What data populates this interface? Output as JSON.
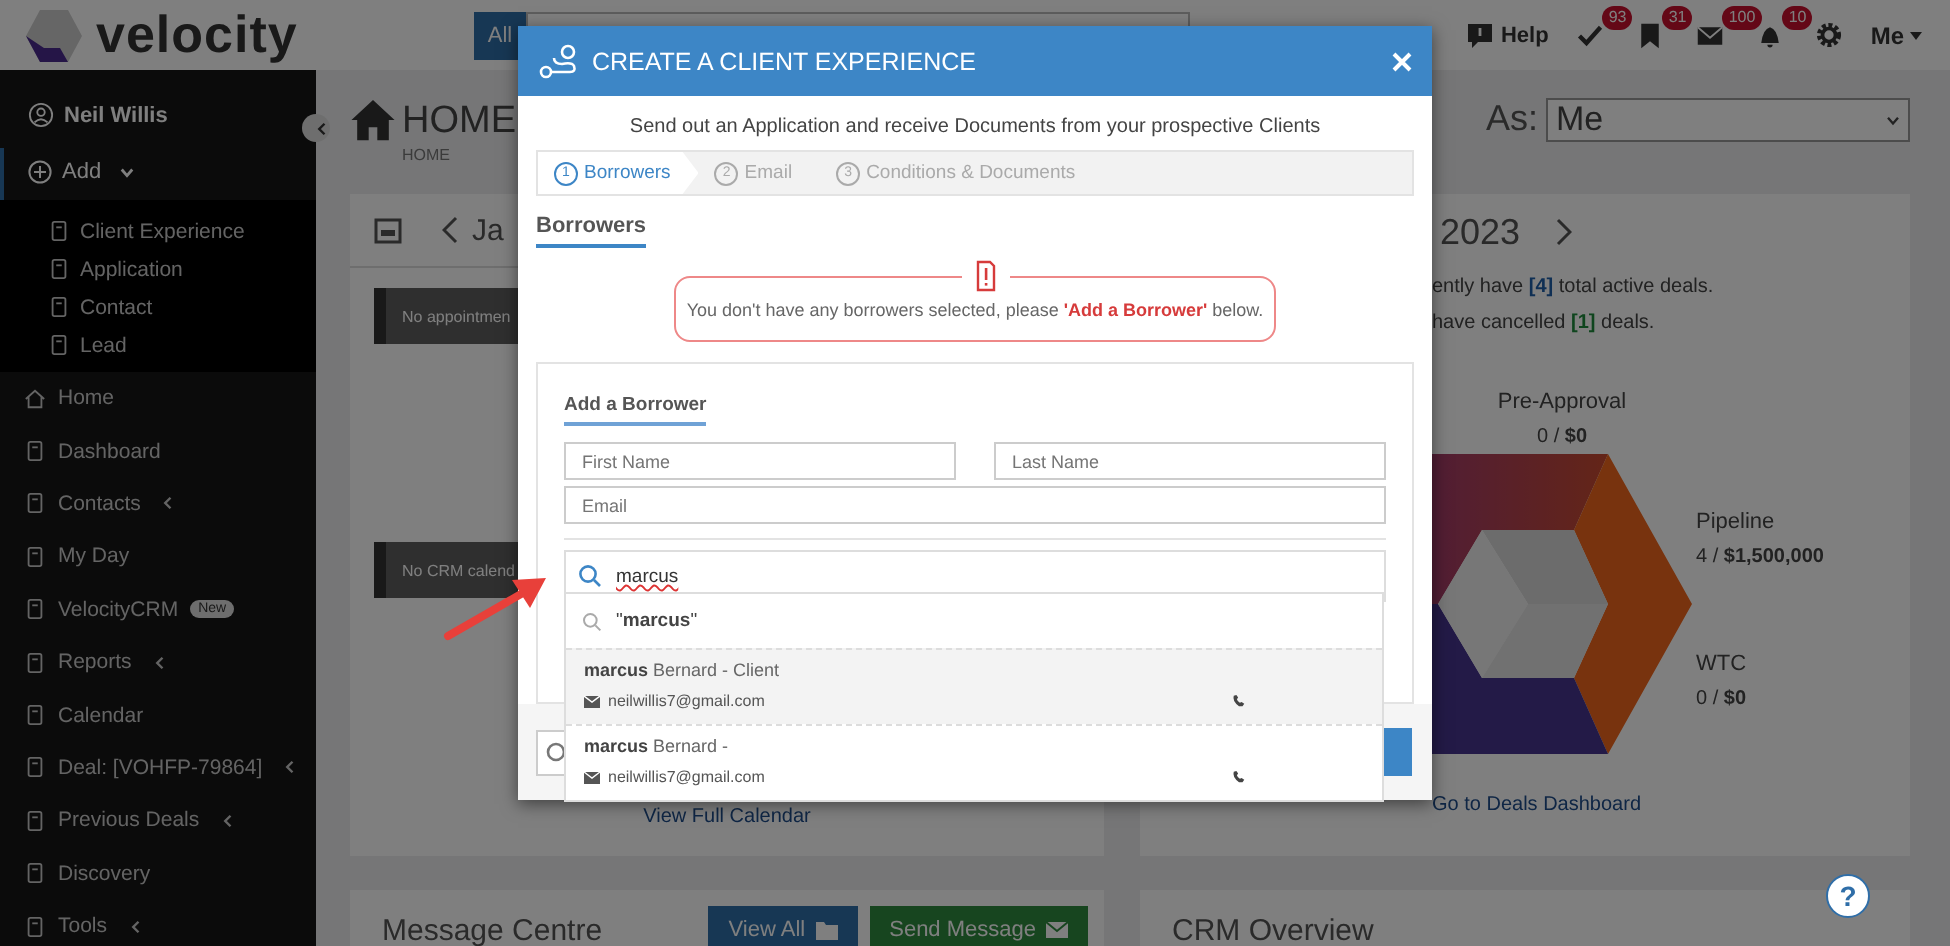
{
  "topbar": {
    "logo": "velocity",
    "search_scope": "All",
    "help": "Help",
    "notifications": [
      {
        "badge": "93"
      },
      {
        "badge": "31"
      },
      {
        "badge": "100"
      },
      {
        "badge": "10"
      }
    ],
    "user_menu": "Me"
  },
  "sidebar": {
    "user": "Neil Willis",
    "add": {
      "label": "Add",
      "expanded": true,
      "children": [
        {
          "label": "Client Experience"
        },
        {
          "label": "Application"
        },
        {
          "label": "Contact"
        },
        {
          "label": "Lead"
        }
      ]
    },
    "items": [
      {
        "label": "Home",
        "kind": "link"
      },
      {
        "label": "Dashboard",
        "kind": "link"
      },
      {
        "label": "Contacts",
        "kind": "submenu"
      },
      {
        "label": "My Day",
        "kind": "link"
      },
      {
        "label": "VelocityCRM",
        "kind": "link",
        "badge": "New"
      },
      {
        "label": "Reports",
        "kind": "submenu"
      },
      {
        "label": "Calendar",
        "kind": "link"
      },
      {
        "label": "Deal: [VOHFP-79864]",
        "kind": "submenu"
      },
      {
        "label": "Previous Deals",
        "kind": "submenu"
      },
      {
        "label": "Discovery",
        "kind": "link"
      },
      {
        "label": "Tools",
        "kind": "submenu"
      }
    ]
  },
  "page_header": {
    "title": "HOME",
    "breadcrumb": "HOME",
    "as_label": "As:",
    "as_value": "Me"
  },
  "calendar_card": {
    "month": "Ja",
    "notices": [
      "No appointmen",
      "No CRM calend"
    ],
    "link": "View Full Calendar"
  },
  "deals_card": {
    "year": "2023",
    "lines": [
      {
        "before": "ently have ",
        "count": "[4]",
        "after": " total active deals.",
        "kind": "active"
      },
      {
        "before": "have cancelled ",
        "count": "[1]",
        "after": " deals.",
        "kind": "cancelled"
      }
    ],
    "stages": [
      {
        "name": "Pre-Approval",
        "value": "0 / **$0**"
      },
      {
        "name": "Pipeline",
        "value": "4 / **$1,500,000**"
      },
      {
        "name": "WTC",
        "value": "0 / **$0**"
      }
    ],
    "link": "Go to Deals Dashboard"
  },
  "message_centre": {
    "title": "Message Centre",
    "buttons": [
      {
        "label": "View All",
        "kind": "primary"
      },
      {
        "label": "Send Message",
        "kind": "success"
      }
    ]
  },
  "crm_overview": {
    "title": "CRM Overview"
  },
  "help_button": "?",
  "modal": {
    "title": "CREATE A CLIENT EXPERIENCE",
    "subtitle": "Send out an Application and receive Documents from your prospective Clients",
    "steps": [
      {
        "number": "1",
        "label": "Borrowers",
        "selected": true
      },
      {
        "number": "2",
        "label": "Email",
        "selected": false
      },
      {
        "number": "3",
        "label": "Conditions & Documents",
        "selected": false
      }
    ],
    "section": "Borrowers",
    "alert": "You don't have any borrowers selected, please **'Add a Borrower'** below.",
    "panel": {
      "title": "Add a Borrower",
      "fields": [
        {
          "placeholder": "First Name"
        },
        {
          "placeholder": "Last Name"
        },
        {
          "placeholder": "Email"
        }
      ],
      "search": {
        "value": "marcus"
      },
      "query": "\"**marcus**\"",
      "results": [
        {
          "name": "**marcus** Bernard - Client",
          "email": "neilwillis7@gmail.com",
          "selected": true
        },
        {
          "name": "**marcus** Bernard -",
          "email": "neilwillis7@gmail.com",
          "selected": false
        }
      ]
    }
  }
}
